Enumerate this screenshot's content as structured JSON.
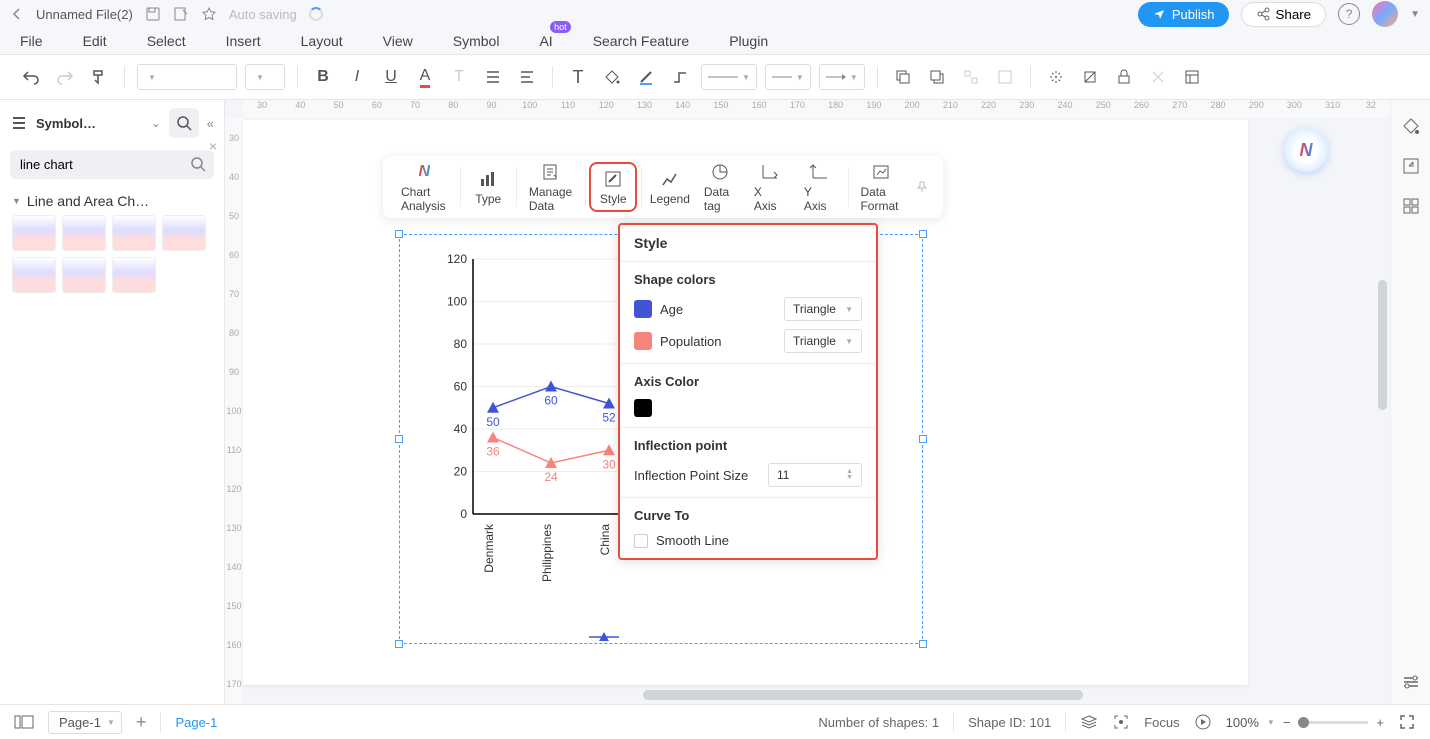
{
  "header": {
    "filename": "Unnamed File(2)",
    "autosave": "Auto saving",
    "publish": "Publish",
    "share": "Share"
  },
  "menu": {
    "items": [
      "File",
      "Edit",
      "Select",
      "Insert",
      "Layout",
      "View",
      "Symbol",
      "AI",
      "Search Feature",
      "Plugin"
    ],
    "hot_badge": "hot"
  },
  "left": {
    "library": "Symbol…",
    "search_value": "line chart",
    "category": "Line and Area Ch…"
  },
  "ruler_h": [
    "30",
    "40",
    "50",
    "60",
    "70",
    "80",
    "90",
    "100",
    "110",
    "120",
    "130",
    "140",
    "150",
    "160",
    "170",
    "180",
    "190",
    "200",
    "210",
    "220",
    "230",
    "240",
    "250",
    "260",
    "270",
    "280",
    "290",
    "300",
    "310",
    "32"
  ],
  "ruler_v": [
    "30",
    "40",
    "50",
    "60",
    "70",
    "80",
    "90",
    "100",
    "110",
    "120",
    "130",
    "140",
    "150",
    "160",
    "170"
  ],
  "chart_toolbar": {
    "items": [
      "Chart Analysis",
      "Type",
      "Manage Data",
      "Style",
      "Legend",
      "Data tag",
      "X Axis",
      "Y Axis",
      "Data Format"
    ]
  },
  "style_panel": {
    "title": "Style",
    "shape_colors": "Shape colors",
    "series": [
      {
        "name": "Age",
        "shape": "Triangle"
      },
      {
        "name": "Population",
        "shape": "Triangle"
      }
    ],
    "axis_color": "Axis Color",
    "inflection": "Inflection point",
    "inflection_size_label": "Inflection Point Size",
    "inflection_size": "11",
    "curve_to": "Curve To",
    "smooth": "Smooth Line"
  },
  "chart_data": {
    "type": "line",
    "categories": [
      "Denmark",
      "Philippines",
      "China"
    ],
    "series": [
      {
        "name": "Age",
        "color": "#4055d6",
        "values": [
          50,
          60,
          52
        ]
      },
      {
        "name": "Population",
        "color": "#f5847b",
        "values": [
          36,
          24,
          30
        ]
      }
    ],
    "ylim": [
      0,
      120
    ],
    "yticks": [
      0,
      20,
      40,
      60,
      80,
      100,
      120
    ],
    "marker": "triangle"
  },
  "bottom": {
    "page_select": "Page-1",
    "page_tab": "Page-1",
    "shapes": "Number of shapes: 1",
    "shape_id": "Shape ID: 101",
    "focus": "Focus",
    "zoom": "100%"
  }
}
